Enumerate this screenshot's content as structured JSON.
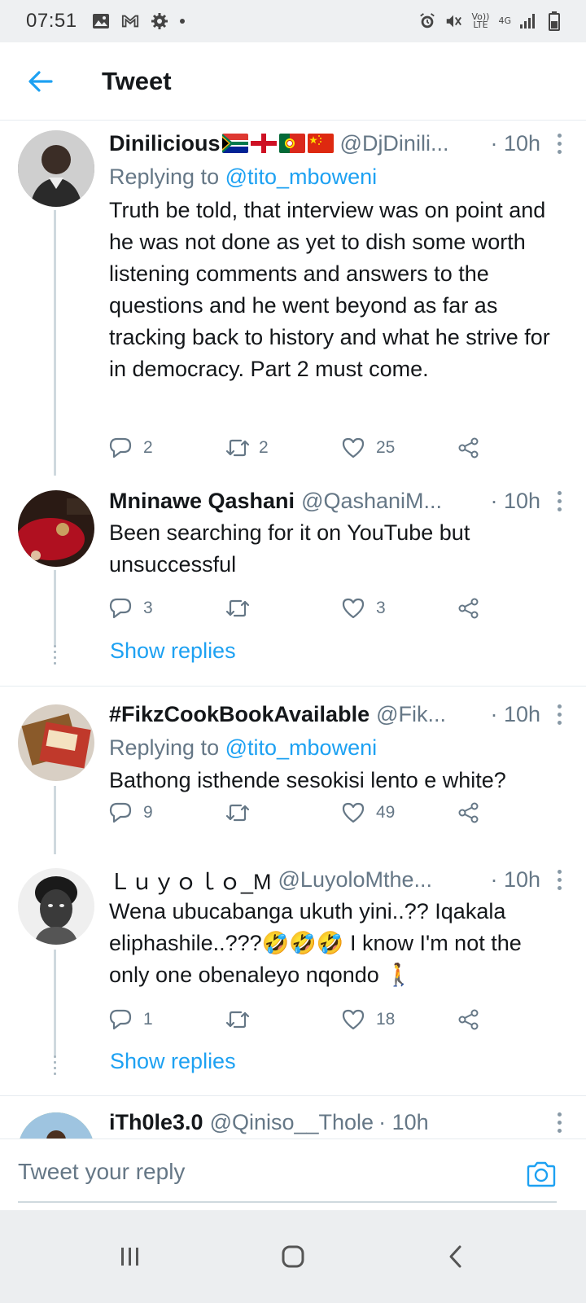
{
  "status_bar": {
    "time": "07:51",
    "network_volte": "Vo)) LTE",
    "network_4g": "4G",
    "icons": [
      "gallery-icon",
      "gmail-icon",
      "settings-icon",
      "alarm-icon",
      "mute-icon",
      "volte-icon",
      "4g-icon",
      "signal-icon",
      "battery-icon"
    ]
  },
  "header": {
    "title": "Tweet",
    "back_icon": "back-arrow-icon"
  },
  "tweets": [
    {
      "name": "Dinilicious",
      "flags": [
        "south-africa",
        "england",
        "portugal",
        "china"
      ],
      "handle": "@DjDinili...",
      "time": "· 10h",
      "replying_prefix": "Replying to",
      "replying_to": "@tito_mboweni",
      "text": "Truth be told, that interview was on point and he was not done as yet to dish some worth listening comments and answers to the questions and he went beyond as far as tracking back to history and what he strive for in democracy. Part 2 must come.",
      "replies": "2",
      "retweets": "2",
      "likes": "25"
    },
    {
      "name": "Mninawe Qashani",
      "handle": "@QashaniM...",
      "time": "· 10h",
      "text": "Been searching for it on YouTube but unsuccessful",
      "replies": "3",
      "retweets": "",
      "likes": "3",
      "show_replies": "Show replies"
    },
    {
      "name": "#FikzCookBookAvailable",
      "handle": "@Fik...",
      "time": "· 10h",
      "replying_prefix": "Replying to",
      "replying_to": "@tito_mboweni",
      "text": "Bathong isthende sesokisi lento e white?",
      "replies": "9",
      "retweets": "",
      "likes": "49"
    },
    {
      "name": "Ｌｕｙｏｌｏ_M",
      "handle": "@LuyoloMthe...",
      "time": "· 10h",
      "text": "Wena ubucabanga ukuth yini..?? Iqakala eliphashile..???🤣🤣🤣 I know I'm not the only one obenaleyo nqondo 🚶",
      "replies": "1",
      "retweets": "",
      "likes": "18",
      "show_replies": "Show replies"
    },
    {
      "name": "iTh0le3.0",
      "handle": "@Qiniso__Thole",
      "time": "· 10h"
    }
  ],
  "reply_bar": {
    "placeholder": "Tweet your reply",
    "camera_icon": "camera-icon"
  },
  "nav_bar": {
    "icons": [
      "recent-apps-icon",
      "home-icon",
      "back-icon"
    ]
  },
  "colors": {
    "accent": "#1da1f2",
    "secondary_text": "#657786",
    "thread_line": "#cfd9de"
  }
}
